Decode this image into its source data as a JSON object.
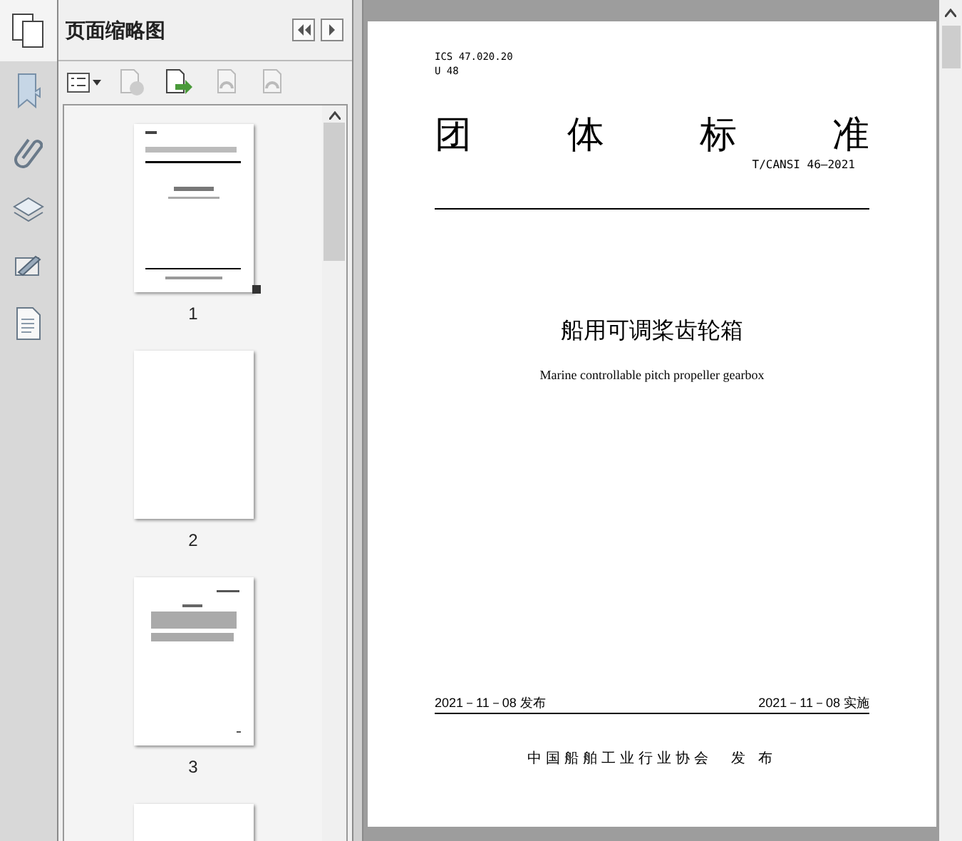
{
  "panel": {
    "title": "页面缩略图"
  },
  "thumbnails": [
    {
      "label": "1",
      "selected": true,
      "kind": "cover"
    },
    {
      "label": "2",
      "selected": false,
      "kind": "blank"
    },
    {
      "label": "3",
      "selected": false,
      "kind": "text"
    },
    {
      "kind": "blank"
    }
  ],
  "document": {
    "ics": "ICS 47.020.20",
    "code": "U 48",
    "title_chars": [
      "团",
      "体",
      "标",
      "准"
    ],
    "number": "T/CANSI 46—2021",
    "name_cn": "船用可调桨齿轮箱",
    "name_en": "Marine controllable pitch propeller gearbox",
    "issue_date": "2021－11－08 发布",
    "impl_date": "2021－11－08 实施",
    "publisher": "中国船舶工业行业协会　发 布"
  }
}
